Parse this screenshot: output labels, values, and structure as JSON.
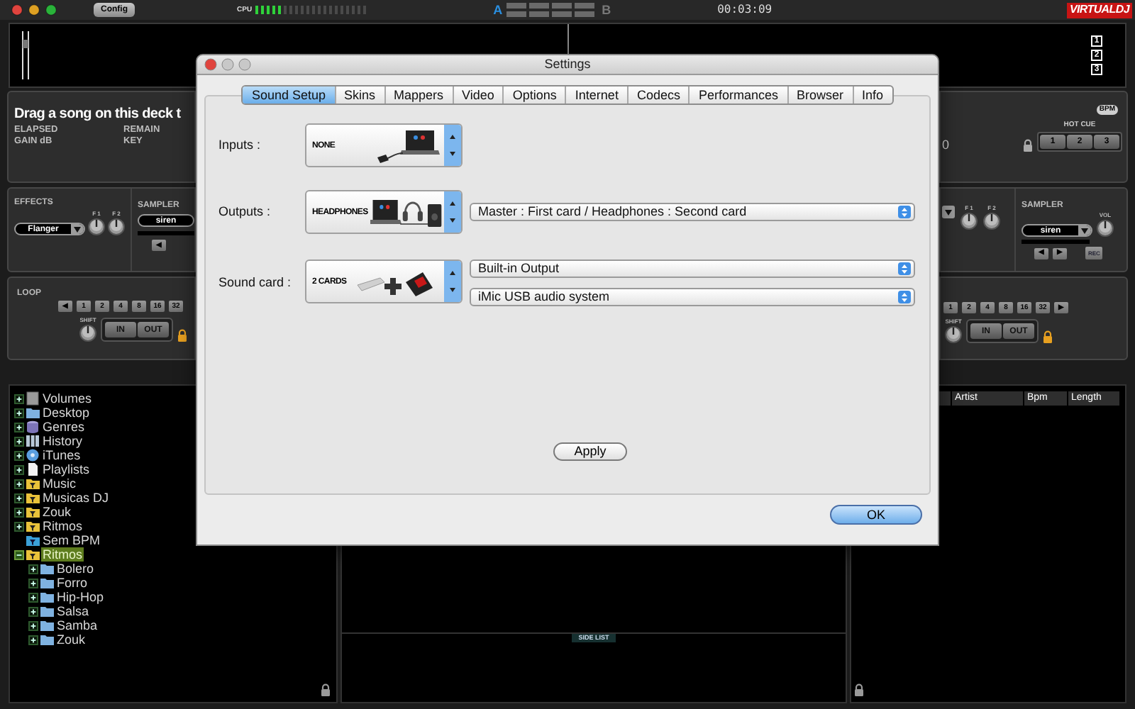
{
  "top_bar": {
    "config_button": "Config",
    "cpu": {
      "label": "CPU",
      "level": 0.25
    },
    "deck_a": {
      "label": "A",
      "selected": true
    },
    "deck_b": {
      "label": "B",
      "selected": false
    },
    "time": "00:03:09",
    "logo": "VIRTUALDJ"
  },
  "waveform": {
    "buttons": [
      "1",
      "2",
      "3"
    ]
  },
  "left_deck": {
    "title": "Drag a song on this deck t",
    "labels": [
      "ELAPSED",
      "REMAIN",
      "GAIN dB",
      "KEY"
    ],
    "effects": {
      "label": "EFFECTS",
      "dropdown": "Flanger",
      "knobs": [
        "F 1",
        "F 2"
      ]
    },
    "sampler": {
      "label": "SAMPLER",
      "dropdown": "siren",
      "buttons": [
        "◀"
      ]
    },
    "loop": {
      "label": "LOOP",
      "buttons": [
        "◀",
        "1",
        "2",
        "4",
        "8",
        "16",
        "32"
      ],
      "shift": "SHIFT",
      "in": "IN",
      "out": "OUT"
    }
  },
  "right_deck": {
    "value": "0",
    "hot_cue": {
      "label": "HOT CUE",
      "buttons": [
        "1",
        "2",
        "3"
      ]
    },
    "bpm_badge": "BPM",
    "effects": {
      "knobs": [
        "F 1",
        "F 2"
      ]
    },
    "sampler": {
      "label": "SAMPLER",
      "dropdown": "siren",
      "vol": "VOL",
      "buttons": [
        "◀",
        "▶"
      ],
      "rec": "REC"
    },
    "loop": {
      "buttons": [
        "1",
        "2",
        "4",
        "8",
        "16",
        "32",
        "▶"
      ],
      "shift": "SHIFT",
      "in": "IN",
      "out": "OUT"
    }
  },
  "browser": {
    "tree": [
      {
        "label": "Volumes",
        "kind": "drive",
        "expandable": true,
        "expanded": false,
        "selected": false
      },
      {
        "label": "Desktop",
        "kind": "folder",
        "expandable": true,
        "expanded": false,
        "selected": false
      },
      {
        "label": "Genres",
        "kind": "genres",
        "expandable": true,
        "expanded": false,
        "selected": false
      },
      {
        "label": "History",
        "kind": "history",
        "expandable": true,
        "expanded": false,
        "selected": false
      },
      {
        "label": "iTunes",
        "kind": "itunes",
        "expandable": true,
        "expanded": false,
        "selected": false
      },
      {
        "label": "Playlists",
        "kind": "playlist",
        "expandable": true,
        "expanded": false,
        "selected": false
      },
      {
        "label": "Music",
        "kind": "filter",
        "expandable": true,
        "expanded": false,
        "selected": false
      },
      {
        "label": "Musicas DJ",
        "kind": "filter",
        "expandable": true,
        "expanded": false,
        "selected": false
      },
      {
        "label": "Zouk",
        "kind": "filter",
        "expandable": true,
        "expanded": false,
        "selected": false
      },
      {
        "label": "Ritmos",
        "kind": "filter",
        "expandable": true,
        "expanded": false,
        "selected": false
      },
      {
        "label": "Sem BPM",
        "kind": "filter_blue",
        "expandable": false,
        "selected": false
      },
      {
        "label": "Ritmos",
        "kind": "filter",
        "expandable": true,
        "expanded": true,
        "selected": true,
        "children": [
          {
            "label": "Bolero",
            "kind": "folder",
            "expandable": true,
            "expanded": false,
            "selected": false
          },
          {
            "label": "Forro",
            "kind": "folder",
            "expandable": true,
            "expanded": false,
            "selected": false
          },
          {
            "label": "Hip-Hop",
            "kind": "folder",
            "expandable": true,
            "expanded": false,
            "selected": false
          },
          {
            "label": "Salsa",
            "kind": "folder",
            "expandable": true,
            "expanded": false,
            "selected": false
          },
          {
            "label": "Samba",
            "kind": "folder",
            "expandable": true,
            "expanded": false,
            "selected": false
          },
          {
            "label": "Zouk",
            "kind": "folder",
            "expandable": true,
            "expanded": false,
            "selected": false
          }
        ]
      }
    ],
    "side_list": "SIDE LIST",
    "columns": [
      "Artist",
      "Bpm",
      "Length"
    ]
  },
  "dialog": {
    "title": "Settings",
    "tabs": [
      {
        "label": "Sound Setup",
        "selected": true
      },
      {
        "label": "Skins",
        "selected": false
      },
      {
        "label": "Mappers",
        "selected": false
      },
      {
        "label": "Video",
        "selected": false
      },
      {
        "label": "Options",
        "selected": false
      },
      {
        "label": "Internet",
        "selected": false
      },
      {
        "label": "Codecs",
        "selected": false
      },
      {
        "label": "Performances",
        "selected": false
      },
      {
        "label": "Browser",
        "selected": false
      },
      {
        "label": "Info",
        "selected": false
      }
    ],
    "rows": [
      {
        "label": "Inputs :",
        "selector": {
          "label": "NONE",
          "kind": "inputs"
        }
      },
      {
        "label": "Outputs :",
        "selector": {
          "label": "HEADPHONES",
          "kind": "outputs"
        },
        "dropdowns": [
          "Master : First card / Headphones : Second card"
        ]
      },
      {
        "label": "Sound card :",
        "selector": {
          "label": "2 CARDS",
          "kind": "soundcard"
        },
        "dropdowns": [
          "Built-in Output",
          "iMic USB audio system"
        ]
      }
    ],
    "apply": "Apply",
    "ok": "OK"
  }
}
